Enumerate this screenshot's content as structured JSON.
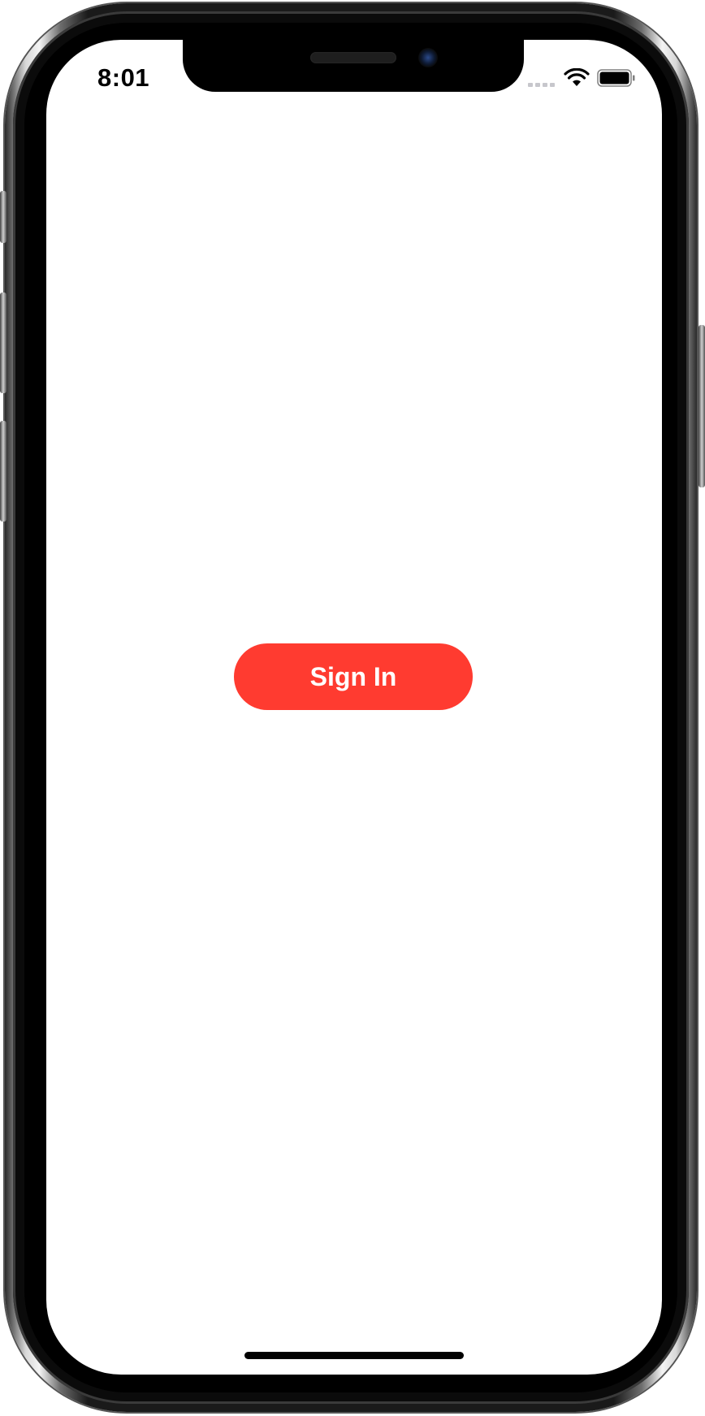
{
  "status_bar": {
    "time": "8:01",
    "icons": [
      "cellular-signal-icon",
      "wifi-icon",
      "battery-icon"
    ]
  },
  "main": {
    "signin_label": "Sign In"
  },
  "colors": {
    "accent": "#ff3b30",
    "screen_background": "#ffffff",
    "text_on_accent": "#ffffff"
  }
}
